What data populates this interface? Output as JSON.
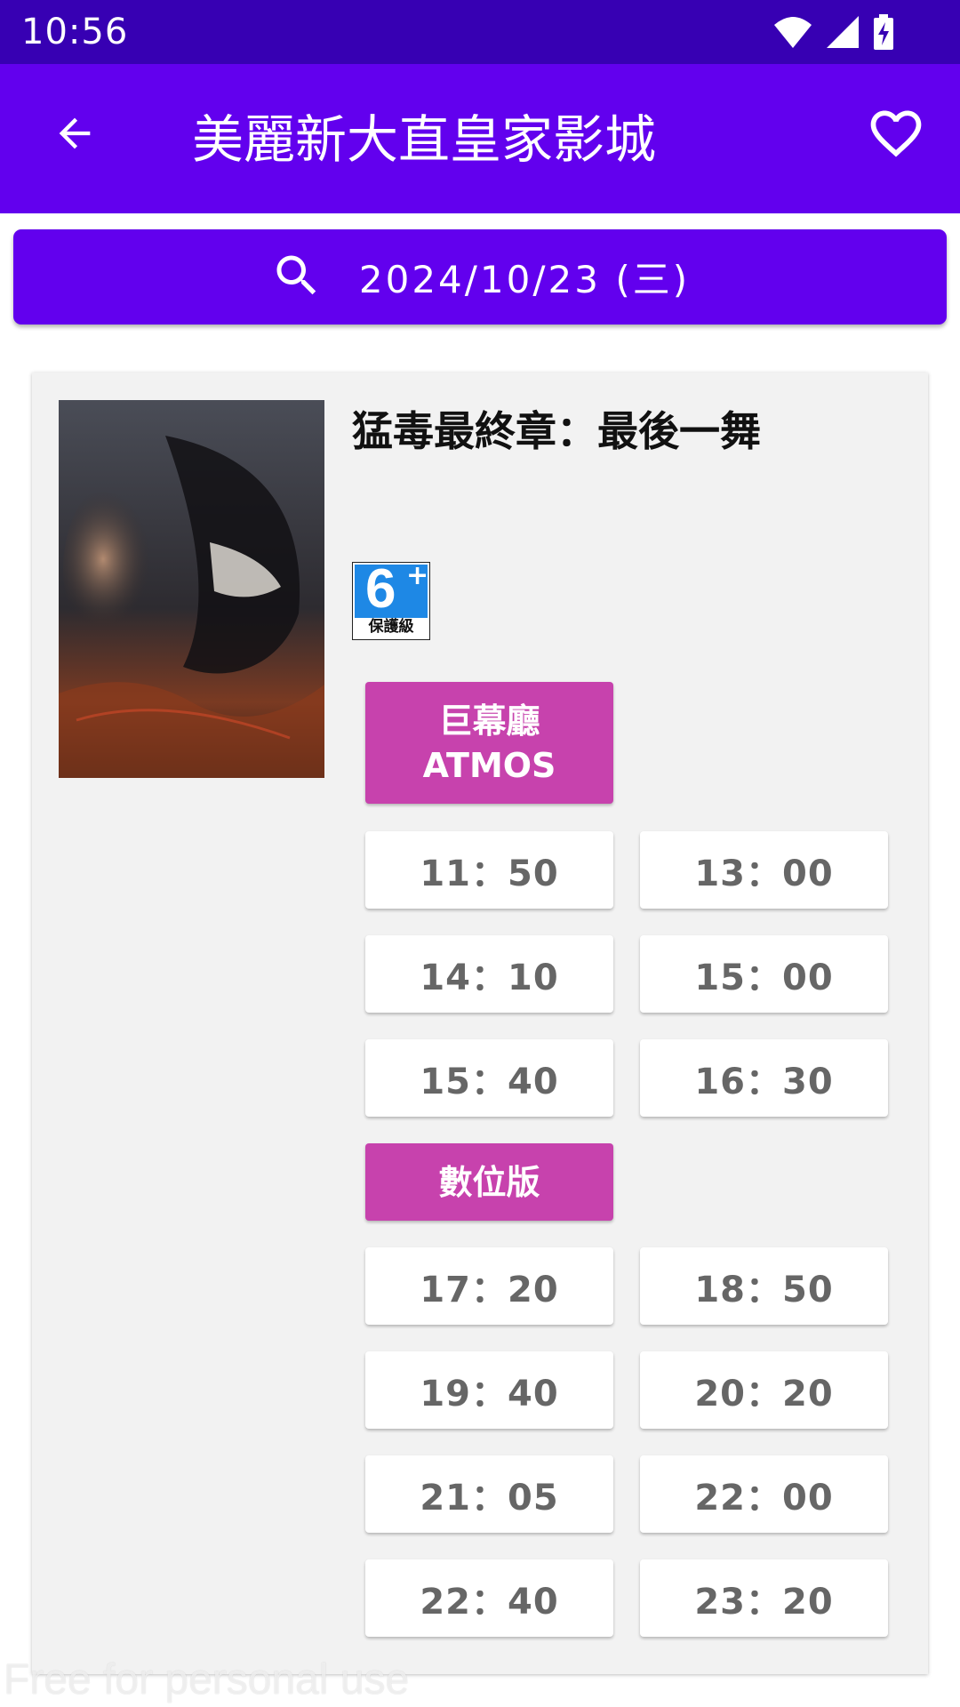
{
  "status_bar": {
    "time": "10:56"
  },
  "app_bar": {
    "title": "美麗新大直皇家影城"
  },
  "date_bar": {
    "date": "2024/10/23 (三)"
  },
  "movie": {
    "title": "猛毒最終章：最後一舞",
    "rating": {
      "number": "6",
      "plus": "+",
      "label": "保護級"
    },
    "formats": [
      {
        "name_line1": "巨幕廳",
        "name_line2": "ATMOS",
        "times": [
          "11：50",
          "13：00",
          "14：10",
          "15：00",
          "15：40",
          "16：30"
        ]
      },
      {
        "name_line1": "數位版",
        "name_line2": "",
        "times": [
          "17：20",
          "18：50",
          "19：40",
          "20：20",
          "21：05",
          "22：00",
          "22：40",
          "23：20"
        ]
      }
    ]
  },
  "watermark": "Free for personal use",
  "colors": {
    "status_bar": "#3700b3",
    "primary": "#6200ee",
    "format_label": "#c742ad",
    "card_bg": "#f2f2f2",
    "time_text": "#666666"
  }
}
